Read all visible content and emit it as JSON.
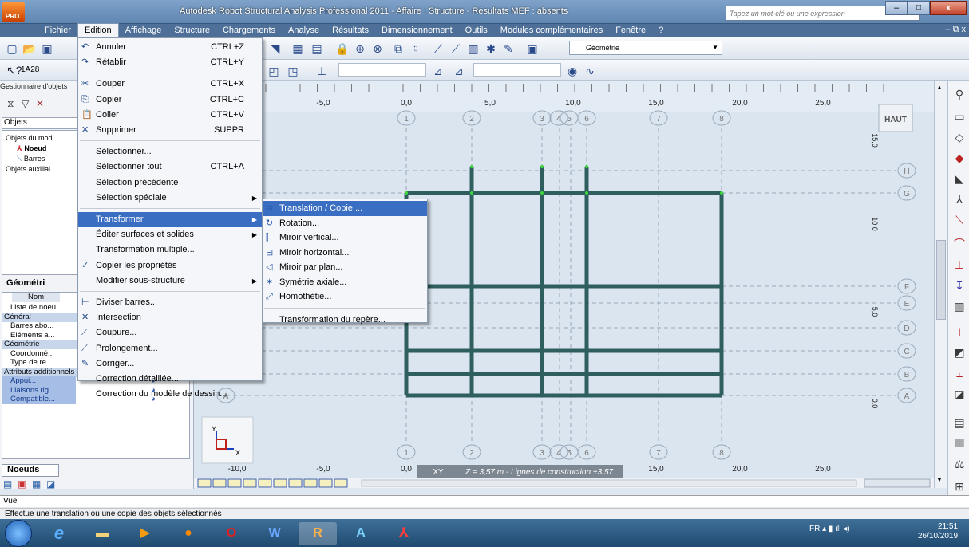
{
  "window": {
    "title": "Autodesk Robot Structural Analysis Professional 2011 - Affaire : Structure - Résultats MEF : absents",
    "logo_text": "PRO",
    "help_search_placeholder": "Tapez un mot-clé ou une expression",
    "minimize": "–",
    "maximize": "□",
    "close": "x"
  },
  "menubar": {
    "items": [
      "Fichier",
      "Edition",
      "Affichage",
      "Structure",
      "Chargements",
      "Analyse",
      "Résultats",
      "Dimensionnement",
      "Outils",
      "Modules complémentaires",
      "Fenêtre",
      "?"
    ],
    "active": "Edition",
    "mdi_controls": "– ⧉ x"
  },
  "toolbar": {
    "view_combo": "Géométrie",
    "node_field": "1A28"
  },
  "left_panel": {
    "manager_title": "Gestionnaire d'objets",
    "objets_label": "Objets",
    "tree": [
      "Objets du mod",
      "Noeud",
      "Barres",
      "Objets auxiliai"
    ],
    "geometry_tab": "Géométri",
    "props_header": "Nom",
    "props_rows": [
      {
        "label": "Liste de noeu...",
        "group": false,
        "sel": false
      },
      {
        "label": "Général",
        "group": true,
        "sel": false
      },
      {
        "label": "Barres abo...",
        "group": false,
        "sel": false
      },
      {
        "label": "Eléments a...",
        "group": false,
        "sel": false
      },
      {
        "label": "Géométrie",
        "group": true,
        "sel": false
      },
      {
        "label": "Coordonné...",
        "group": false,
        "sel": false
      },
      {
        "label": "Type de re...",
        "group": false,
        "sel": false
      },
      {
        "label": "Attributs additionnels",
        "group": true,
        "sel": false
      },
      {
        "label": "Appui...",
        "group": false,
        "sel": true
      },
      {
        "label": "Liaisons rig...",
        "group": false,
        "sel": true
      },
      {
        "label": "Compatible...",
        "group": false,
        "sel": true
      }
    ],
    "bottom_tab": "Noeuds"
  },
  "view": {
    "top_ruler": [
      "-5,0",
      "0,0",
      "5,0",
      "10,0",
      "15,0",
      "20,0",
      "25,0"
    ],
    "bottom_ruler": [
      "-10,0",
      "-5,0",
      "0,0",
      "5,0",
      "10,0",
      "15,0",
      "20,0",
      "25,0"
    ],
    "column_labels": [
      "1",
      "2",
      "3",
      "4",
      "5",
      "6",
      "7",
      "8"
    ],
    "row_labels": [
      "A",
      "B",
      "C",
      "D",
      "E",
      "F",
      "G",
      "H"
    ],
    "side_ruler": [
      "15,0",
      "10,0",
      "5,0",
      "0,0"
    ],
    "view_cube": "HAUT",
    "plane_label": "XY",
    "status_overlay": "Z = 3,57 m - Lignes de construction +3,57",
    "axis_y": "Y",
    "axis_x": "X"
  },
  "menu_edition": {
    "items": [
      {
        "label": "Annuler",
        "shortcut": "CTRL+Z",
        "icon": "undo-icon",
        "glyph": "↶"
      },
      {
        "label": "Rétablir",
        "shortcut": "CTRL+Y",
        "icon": "redo-icon",
        "glyph": "↷"
      },
      {
        "label": "Couper",
        "shortcut": "CTRL+X",
        "icon": "cut-icon",
        "glyph": "✂"
      },
      {
        "label": "Copier",
        "shortcut": "CTRL+C",
        "icon": "copy-icon",
        "glyph": "⎘"
      },
      {
        "label": "Coller",
        "shortcut": "CTRL+V",
        "icon": "paste-icon",
        "glyph": "📋"
      },
      {
        "label": "Supprimer",
        "shortcut": "SUPPR",
        "icon": "delete-icon",
        "glyph": "✕"
      },
      {
        "label": "Sélectionner...",
        "shortcut": "",
        "icon": "",
        "glyph": ""
      },
      {
        "label": "Sélectionner tout",
        "shortcut": "CTRL+A",
        "icon": "",
        "glyph": ""
      },
      {
        "label": "Sélection précédente",
        "shortcut": "",
        "icon": "",
        "glyph": ""
      },
      {
        "label": "Sélection spéciale",
        "shortcut": "",
        "icon": "",
        "glyph": "",
        "submenu": true
      },
      {
        "label": "Transformer",
        "shortcut": "",
        "icon": "",
        "glyph": "",
        "submenu": true,
        "highlight": true
      },
      {
        "label": "Éditer surfaces et solides",
        "shortcut": "",
        "icon": "",
        "glyph": "",
        "submenu": true
      },
      {
        "label": "Transformation multiple...",
        "shortcut": "",
        "icon": "",
        "glyph": ""
      },
      {
        "label": "Copier les propriétés",
        "shortcut": "",
        "icon": "copy-properties-icon",
        "glyph": "✓"
      },
      {
        "label": "Modifier sous-structure",
        "shortcut": "",
        "icon": "",
        "glyph": "",
        "submenu": true
      },
      {
        "label": "Diviser barres...",
        "shortcut": "",
        "icon": "divide-bars-icon",
        "glyph": "⊢"
      },
      {
        "label": "Intersection",
        "shortcut": "",
        "icon": "intersection-icon",
        "glyph": "✕"
      },
      {
        "label": "Coupure...",
        "shortcut": "",
        "icon": "cut-line-icon",
        "glyph": "⟋"
      },
      {
        "label": "Prolongement...",
        "shortcut": "",
        "icon": "extend-icon",
        "glyph": "⟋"
      },
      {
        "label": "Corriger...",
        "shortcut": "",
        "icon": "correct-icon",
        "glyph": "✎"
      },
      {
        "label": "Correction détaillée...",
        "shortcut": "",
        "icon": "",
        "glyph": ""
      },
      {
        "label": "Correction du modèle de dessin...",
        "shortcut": "",
        "icon": "",
        "glyph": ""
      }
    ]
  },
  "menu_transform": {
    "items": [
      {
        "label": "Translation / Copie ...",
        "icon": "translation-icon",
        "glyph": "⇉",
        "highlight": true
      },
      {
        "label": "Rotation...",
        "icon": "rotation-icon",
        "glyph": "↻"
      },
      {
        "label": "Miroir vertical...",
        "icon": "mirror-vertical-icon",
        "glyph": "⫿"
      },
      {
        "label": "Miroir horizontal...",
        "icon": "mirror-horizontal-icon",
        "glyph": "⊟"
      },
      {
        "label": "Miroir par plan...",
        "icon": "mirror-plane-icon",
        "glyph": "◁"
      },
      {
        "label": "Symétrie axiale...",
        "icon": "axial-symmetry-icon",
        "glyph": "✶"
      },
      {
        "label": "Homothétie...",
        "icon": "homothety-icon",
        "glyph": "⤢"
      },
      {
        "label": "Transformation du repère...",
        "icon": "",
        "glyph": ""
      }
    ]
  },
  "status": {
    "line1": "Vue",
    "line2": "Effectue une translation ou une copie des objets sélectionnés"
  },
  "taskbar": {
    "lang": "FR",
    "time": "21:51",
    "date": "26/10/2019"
  },
  "colors": {
    "frame": "#2f5f5f",
    "highlight": "#3a6ec2"
  }
}
